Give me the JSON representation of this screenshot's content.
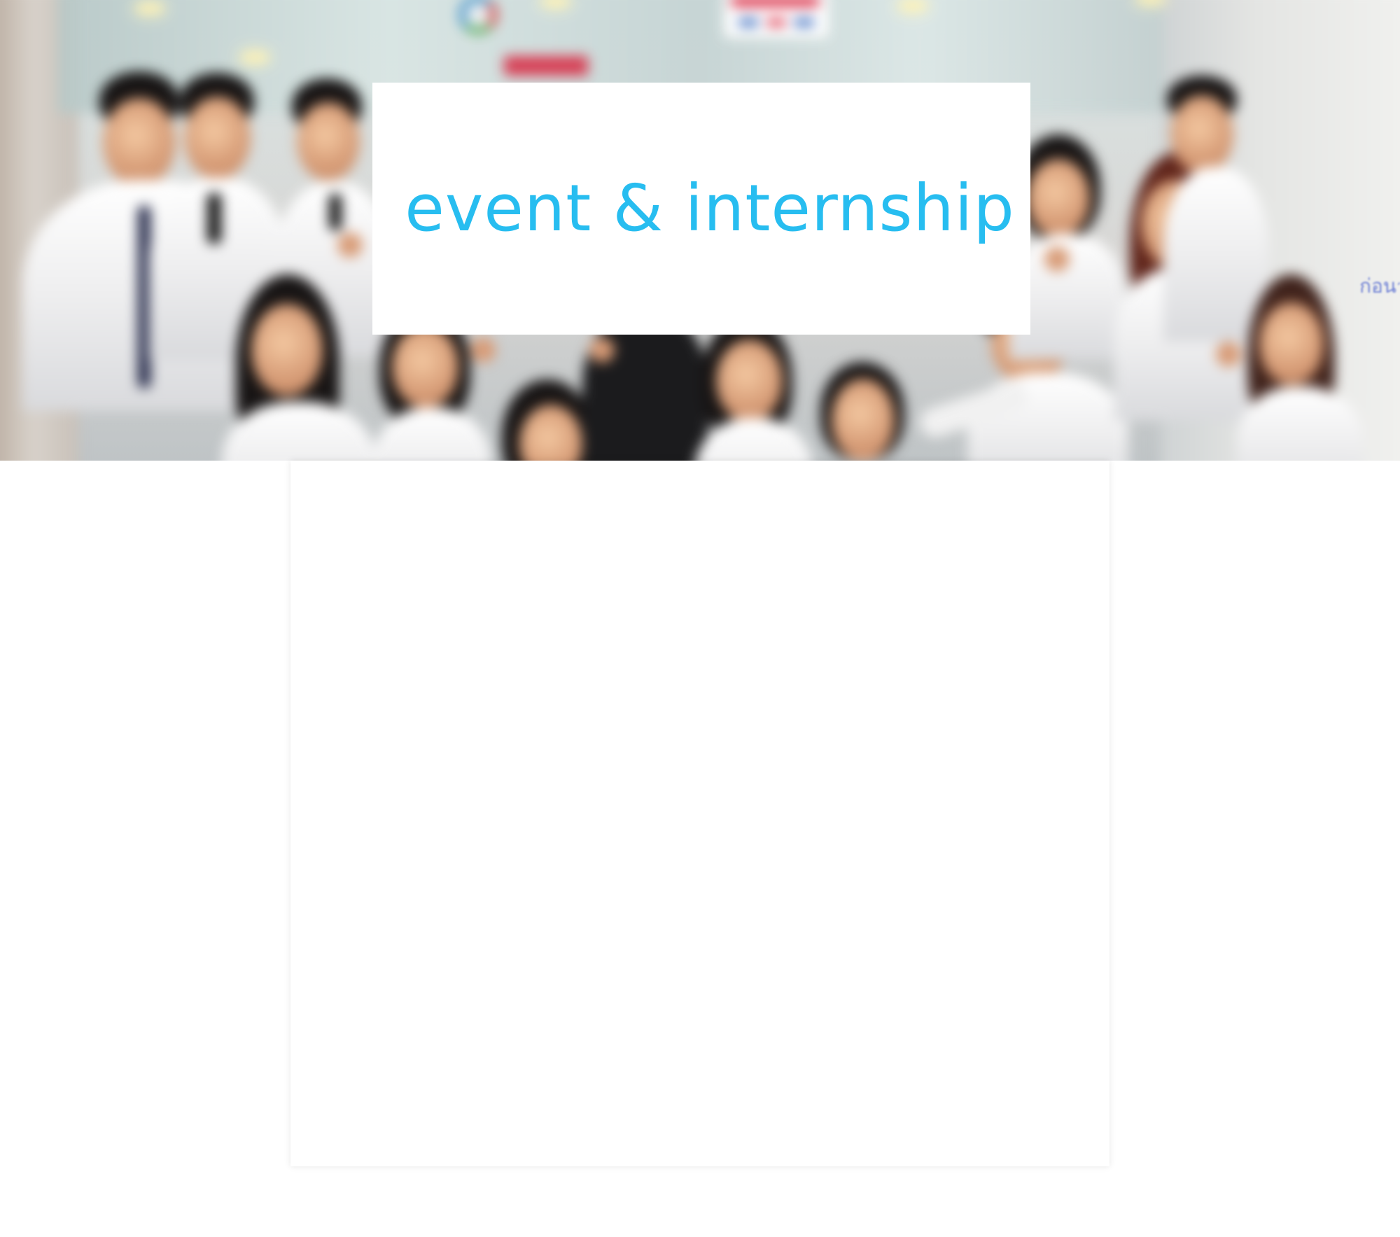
{
  "hero": {
    "title": "event & internship",
    "partial_text": "ก่อนา"
  },
  "colors": {
    "title": "#27bdf0",
    "background": "#ffffff",
    "card_shadow": "rgba(0,0,0,0.10)"
  }
}
